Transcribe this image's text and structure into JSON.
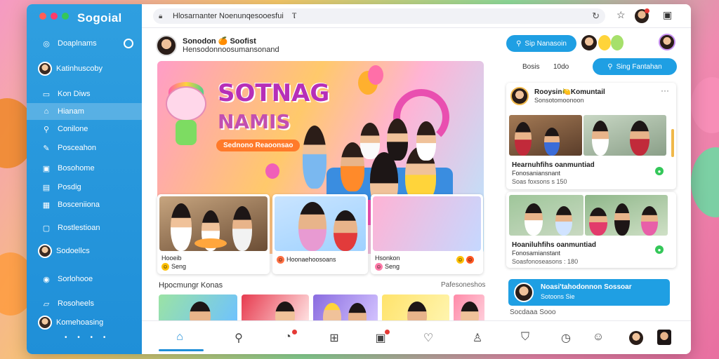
{
  "window": {
    "app_name": "Sogoial",
    "traffic_colors": [
      "#ff5f57",
      "#28c840",
      "#34c759"
    ]
  },
  "sidebar": {
    "items": [
      {
        "label": "Doaplnams",
        "icon": "compass-icon"
      },
      {
        "label": "Katinhuscoby",
        "icon": "avatar"
      },
      {
        "label": "Kon Diws",
        "icon": "book-icon"
      },
      {
        "label": "Hianam",
        "icon": "home-icon",
        "active": true
      },
      {
        "label": "Conilone",
        "icon": "search-icon"
      },
      {
        "label": "Posceahon",
        "icon": "wrench-icon"
      },
      {
        "label": "Bosohome",
        "icon": "image-icon"
      },
      {
        "label": "Posdig",
        "icon": "calendar-icon"
      },
      {
        "label": "Bosceniiona",
        "icon": "grid-icon"
      },
      {
        "label": "Rostlestioan",
        "icon": "chat-icon"
      },
      {
        "label": "Sodoellcs",
        "icon": "user-icon"
      },
      {
        "label": "Sorlohooe",
        "icon": "globe-icon"
      },
      {
        "label": "Rosoheels",
        "icon": "flag-icon"
      },
      {
        "label": "Komehoasing",
        "icon": "avatar"
      }
    ],
    "footer_dots": "• • • •"
  },
  "topbar": {
    "url": "Hlosarnanter Noenunqesooesfui",
    "cursor_mark": "Ⲧ"
  },
  "feed_header": {
    "name": "Sonodon 🍊 Soofist",
    "subtitle": "Hensodonnoosumansonand"
  },
  "banner": {
    "title_line1": "SOTNAG",
    "title_line2": "NAMIS",
    "pill": "Sednono Reaoonsao"
  },
  "cards": [
    {
      "caption": "Hooeib",
      "sub": "Seng"
    },
    {
      "caption": "Hoonaehoosoans",
      "sub": ""
    },
    {
      "caption": "Hsonkon",
      "sub": "Seng"
    }
  ],
  "section": {
    "title": "Hpocmungr Konas",
    "link": "Pafesoneshos"
  },
  "right": {
    "search_button": "Sip Nanasoin",
    "tab_a": "Bosis",
    "tab_b": "10do",
    "follow_button": "Sing Fantahan",
    "post1": {
      "name": "Rooysin🍋Komuntail",
      "sub": "Sonsotomoonoon"
    },
    "post2": {
      "title": "Hearnuhfihs oanmuntiad",
      "sub": "Fonosaniansnant",
      "meta": "Soas foxsons s 150"
    },
    "post3": {
      "title": "Hoaniluhfihs oanmuntiad",
      "sub": "Fonosamianstant",
      "meta": "Soasfonoseasons : 180"
    },
    "promo_title": "Noasi'tahodonnon Sossoar",
    "promo_sub": "Sotoons  Sie",
    "footer_text": "Socdaaa Sooo"
  },
  "bottom_nav": [
    {
      "icon": "home-icon",
      "active": true
    },
    {
      "icon": "search-icon"
    },
    {
      "icon": "notification-icon"
    },
    {
      "icon": "add-icon"
    },
    {
      "icon": "inbox-icon"
    },
    {
      "icon": "heart-icon"
    },
    {
      "icon": "profile-icon"
    },
    {
      "icon": "shield-icon"
    },
    {
      "icon": "history-icon"
    },
    {
      "icon": "face-icon"
    }
  ]
}
